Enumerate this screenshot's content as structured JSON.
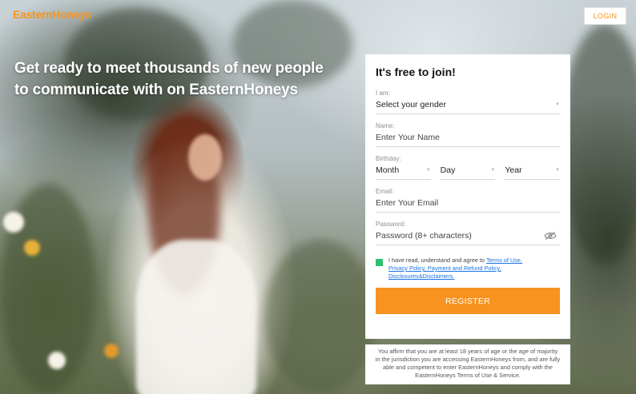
{
  "brand": {
    "logo_text": "EasternHoneys",
    "accent": "#f7931e"
  },
  "header": {
    "login_label": "LOGIN"
  },
  "hero": {
    "headline": "Get ready to meet thousands of new people to communicate with on EasternHoneys"
  },
  "form": {
    "title": "It's free to join!",
    "gender": {
      "label": "I am:",
      "value": "Select your gender"
    },
    "name": {
      "label": "Name:",
      "placeholder": "Enter Your Name"
    },
    "birthday": {
      "label": "Birthday:",
      "month": "Month",
      "day": "Day",
      "year": "Year"
    },
    "email": {
      "label": "Email:",
      "placeholder": "Enter Your Email"
    },
    "password": {
      "label": "Password:",
      "placeholder": "Password (8+ characters)",
      "icon": "eye-slash-icon"
    },
    "terms": {
      "prefix": "I have read, understand and agree to ",
      "link1": "Terms of Use,",
      "link2": "Privacy Policy, Payment and Refund Policy,",
      "link3": "Disclosures&Disclaimers.",
      "checked": true,
      "checkbox_color": "#2fbf71"
    },
    "register_label": "REGISTER"
  },
  "disclaimer": "You affirm that you are at least 18 years of age or the age of majority in the jurisdiction you are accessing EasternHoneys from, and are fully able and competent to enter EasternHoneys and comply with the EasternHoneys Terms of Use & Service."
}
